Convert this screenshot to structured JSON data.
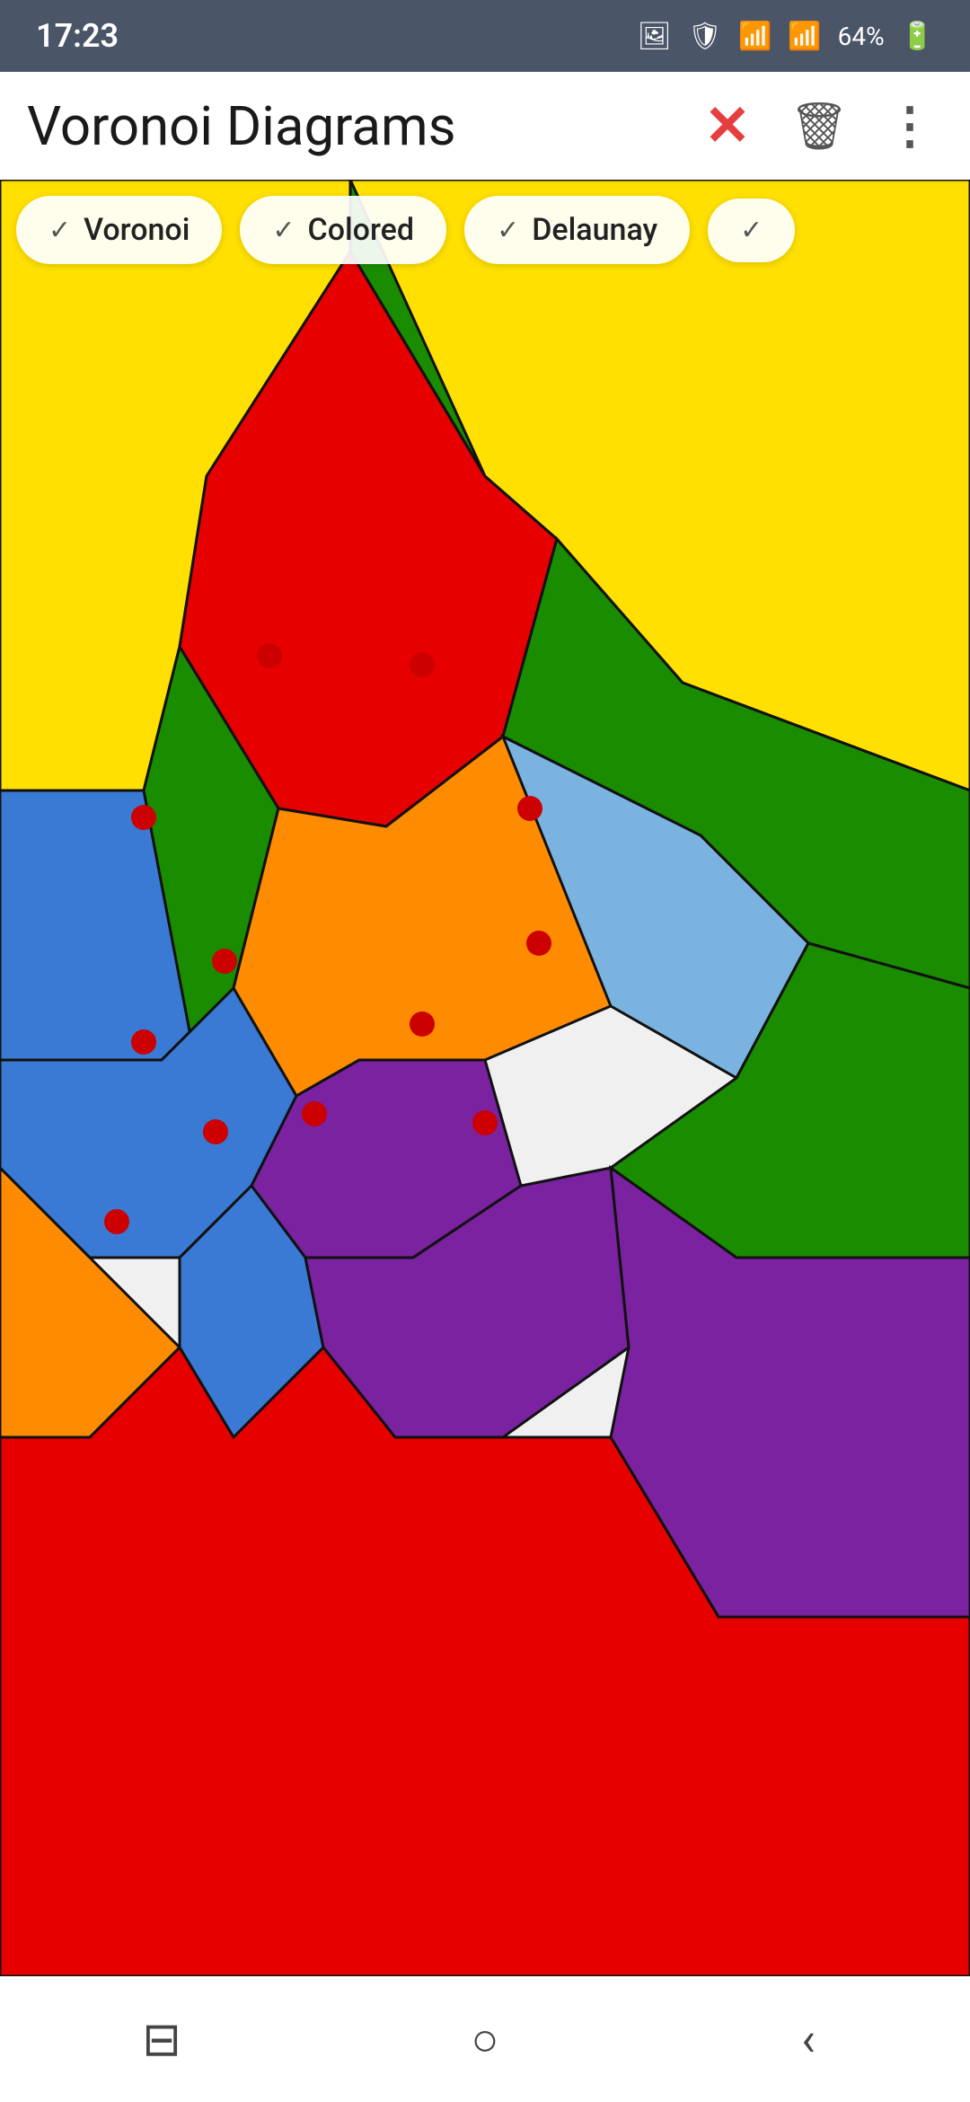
{
  "statusBar": {
    "time": "17:23",
    "battery": "64%"
  },
  "appBar": {
    "title": "Voronoi Diagrams",
    "closeLabel": "✕",
    "trashLabel": "🗑",
    "moreLabel": "⋮"
  },
  "chips": [
    {
      "id": "voronoi",
      "label": "Voronoi",
      "checked": true
    },
    {
      "id": "colored",
      "label": "Colored",
      "checked": true
    },
    {
      "id": "delaunay",
      "label": "Delaunay",
      "checked": true
    },
    {
      "id": "extra",
      "label": "",
      "checked": true
    }
  ],
  "bottomNav": {
    "recentLabel": "|||",
    "homeLabel": "○",
    "backLabel": "<"
  }
}
